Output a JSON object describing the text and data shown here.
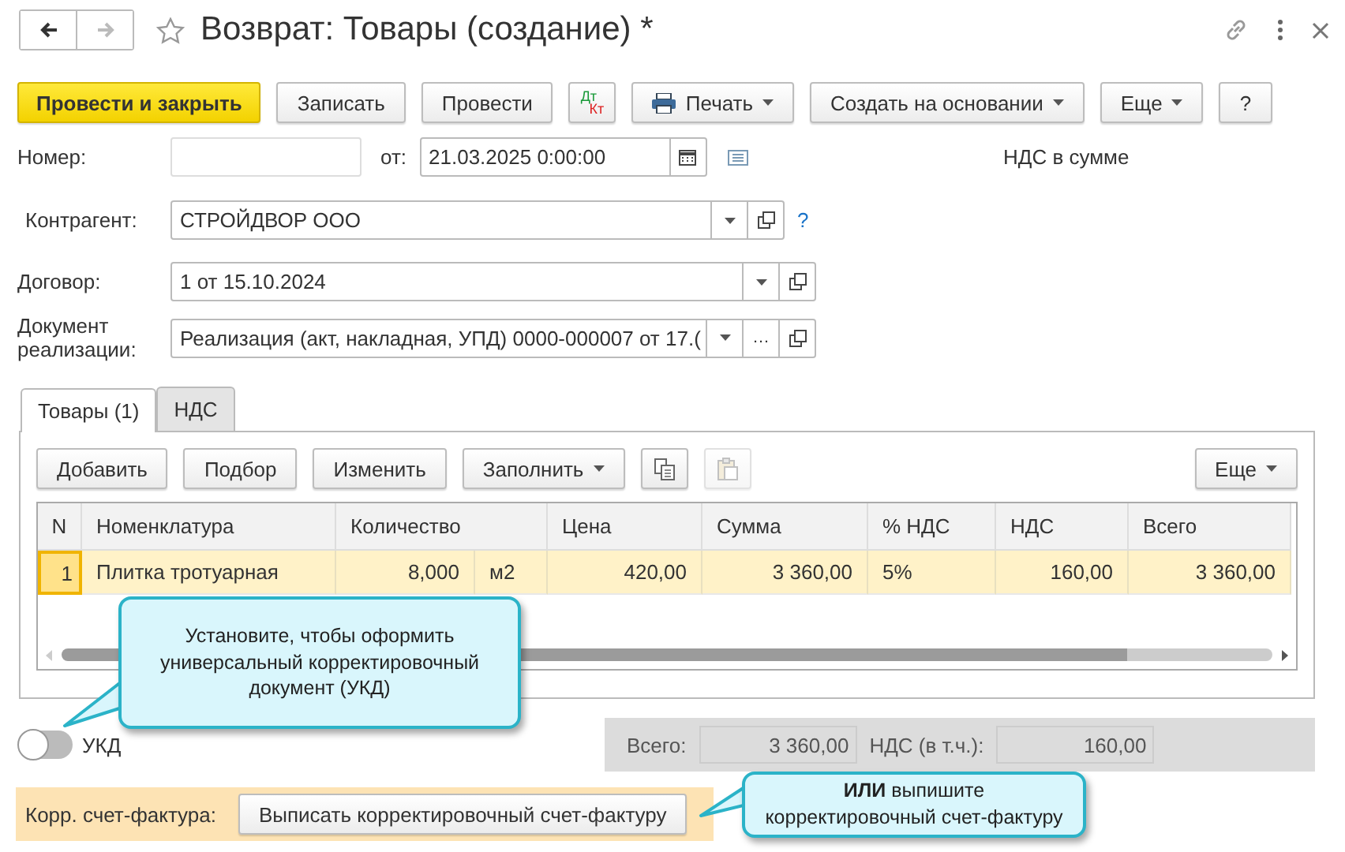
{
  "window": {
    "title": "Возврат: Товары (создание) *"
  },
  "toolbar": [
    {
      "kind": "primary",
      "label": "Провести и закрыть"
    },
    {
      "kind": "plain",
      "label": "Записать"
    },
    {
      "kind": "plain",
      "label": "Провести"
    },
    {
      "kind": "dtkt",
      "label": "Дт",
      "label2": "Кт"
    },
    {
      "kind": "print",
      "label": "Печать"
    },
    {
      "kind": "menu",
      "label": "Создать на основании"
    },
    {
      "kind": "menu",
      "label": "Еще"
    },
    {
      "kind": "plain",
      "label": "?"
    }
  ],
  "number": {
    "label": "Номер:"
  },
  "date": {
    "label": "от:",
    "value": "21.03.2025  0:00:00"
  },
  "vat_mode": "НДС в сумме",
  "counterparty": {
    "label": "Контрагент:",
    "value": "СТРОЙДВОР ООО",
    "help": "?"
  },
  "contract": {
    "label": "Договор:",
    "value": "1 от 15.10.2024"
  },
  "sale_document": {
    "label": "Документ реализации:",
    "value": "Реализация (акт, накладная, УПД) 0000-000007 от 17.(",
    "select_button": "…"
  },
  "tabs": [
    {
      "label": "Товары (1)",
      "selected": true
    },
    {
      "label": "НДС",
      "selected": false
    }
  ],
  "table_toolbar": [
    {
      "kind": "plain",
      "label": "Добавить"
    },
    {
      "kind": "plain",
      "label": "Подбор"
    },
    {
      "kind": "plain",
      "label": "Изменить"
    },
    {
      "kind": "menu",
      "label": "Заполнить"
    },
    {
      "kind": "copy",
      "disabled": false
    },
    {
      "kind": "paste",
      "disabled": true
    },
    {
      "kind": "more",
      "label": "Еще"
    }
  ],
  "table": {
    "columns": [
      "N",
      "Номенклатура",
      "Количество",
      "Цена",
      "Сумма",
      "% НДС",
      "НДС",
      "Всего"
    ],
    "rows": [
      {
        "selected": true,
        "cells": [
          "1",
          "Плитка тротуарная",
          {
            "value": "8,000",
            "unit": "м2"
          },
          "420,00",
          "3 360,00",
          "5%",
          "160,00",
          "3 360,00"
        ]
      }
    ]
  },
  "ukd": {
    "label": "УКД",
    "on": false
  },
  "totals": [
    {
      "label": "Всего:",
      "value": "3 360,00"
    },
    {
      "label": "НДС (в т.ч.):",
      "value": "160,00"
    }
  ],
  "invoice": {
    "label": "Корр. счет-фактура:",
    "button": "Выписать корректировочный счет-фактуру"
  },
  "callouts": [
    {
      "text": "Установите, чтобы оформить универсальный корректировочный документ (УКД)"
    },
    {
      "text": "**ИЛИ** выпишите корректировочный счет-фактуру"
    }
  ]
}
